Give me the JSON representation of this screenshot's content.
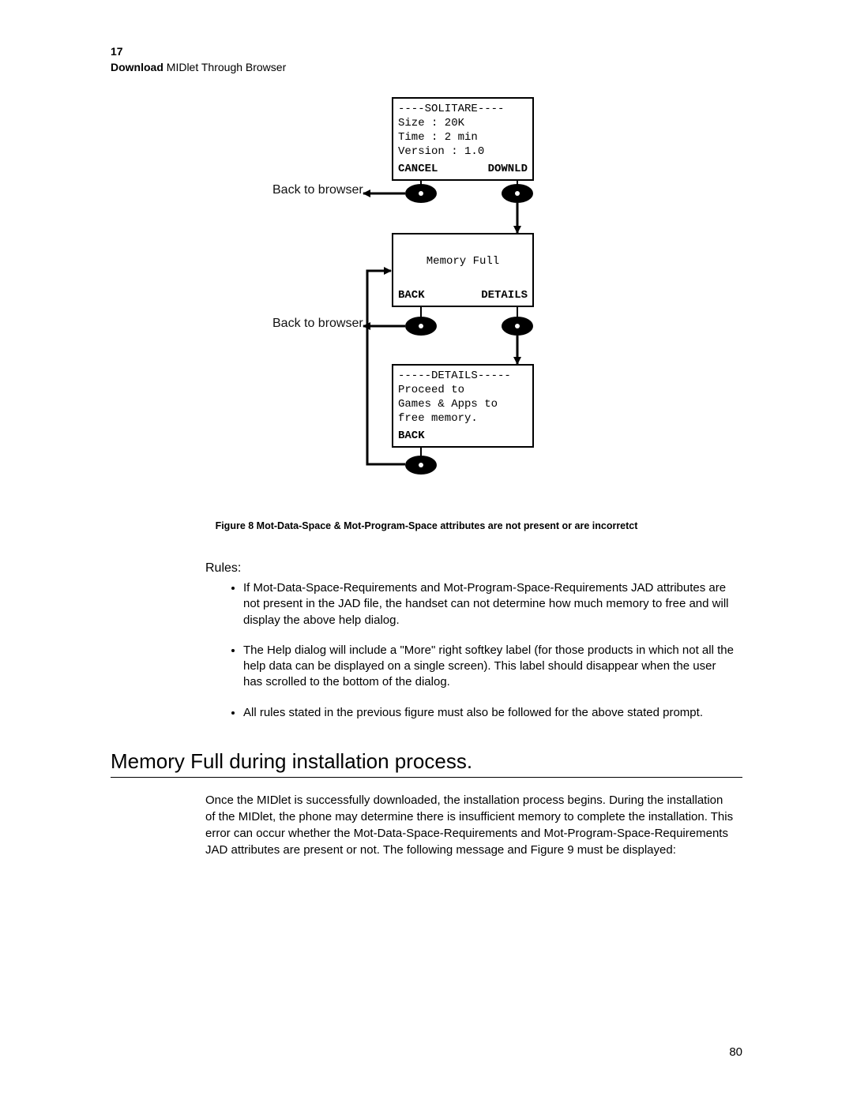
{
  "header": {
    "chapter_number": "17",
    "chapter_bold": "Download",
    "chapter_rest": " MIDlet Through Browser"
  },
  "diagram": {
    "label_back_1": "Back to browser",
    "label_back_2": "Back to browser",
    "box1": {
      "title": "----SOLITARE----",
      "line1": "Size    : 20K",
      "line2": "Time    : 2 min",
      "line3": "Version : 1.0",
      "soft_left": "CANCEL",
      "soft_right": "DOWNLD"
    },
    "box2": {
      "line1": "Memory Full",
      "soft_left": "BACK",
      "soft_right": "DETAILS"
    },
    "box3": {
      "title": "-----DETAILS-----",
      "line1": "Proceed to",
      "line2": "Games & Apps to",
      "line3": "free memory.",
      "soft_left": "BACK"
    }
  },
  "caption": "Figure 8 Mot-Data-Space & Mot-Program-Space attributes are not present or are incorretct",
  "rules_heading": "Rules:",
  "rules": [
    "If Mot-Data-Space-Requirements and Mot-Program-Space-Requirements JAD attributes are not present in the JAD file, the handset can not determine how much memory to free and will display the above help dialog.",
    "The Help dialog will include a \"More\" right softkey label (for those products in which not all the help data can be displayed on a single screen). This label should disappear when the user has scrolled to the bottom of the dialog.",
    " All rules stated in the previous figure must also be followed for the above stated prompt."
  ],
  "section_heading": "Memory Full during installation process.",
  "body_para": "Once the MIDlet is successfully downloaded, the installation process begins. During the installation of the MIDlet, the phone may determine there is insufficient memory to complete the installation. This error can occur whether the Mot-Data-Space-Requirements and Mot-Program-Space-Requirements JAD attributes are present or not. The following message and Figure 9  must be displayed:",
  "page_number": "80"
}
